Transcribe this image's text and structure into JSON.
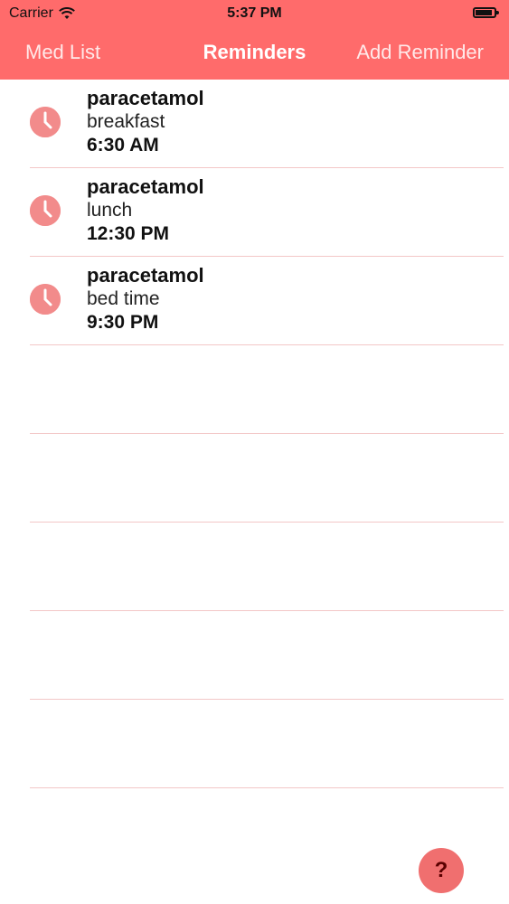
{
  "status_bar": {
    "carrier": "Carrier",
    "time": "5:37 PM",
    "icons": [
      "wifi-icon",
      "battery-icon"
    ]
  },
  "nav": {
    "left": "Med List",
    "title": "Reminders",
    "right": "Add Reminder"
  },
  "reminders": [
    {
      "medication": "paracetamol",
      "meal": "breakfast",
      "time": "6:30 AM"
    },
    {
      "medication": "paracetamol",
      "meal": "lunch",
      "time": "12:30 PM"
    },
    {
      "medication": "paracetamol",
      "meal": "bed time",
      "time": "9:30 PM"
    }
  ],
  "empty_row_count": 5,
  "help": {
    "label": "?"
  },
  "colors": {
    "accent": "#ff6b6b",
    "row_separator": "#f3c7c7",
    "clock": "#f28b8b"
  }
}
